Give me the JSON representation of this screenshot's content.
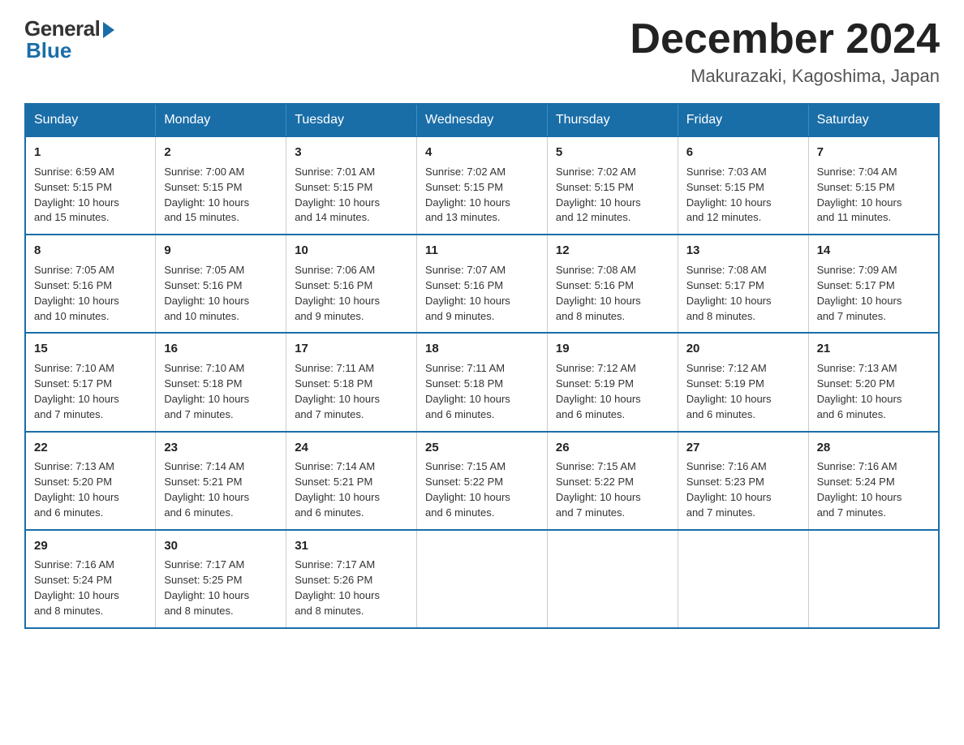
{
  "logo": {
    "general": "General",
    "blue": "Blue"
  },
  "title": "December 2024",
  "subtitle": "Makurazaki, Kagoshima, Japan",
  "days_of_week": [
    "Sunday",
    "Monday",
    "Tuesday",
    "Wednesday",
    "Thursday",
    "Friday",
    "Saturday"
  ],
  "weeks": [
    [
      {
        "day": "1",
        "sunrise": "6:59 AM",
        "sunset": "5:15 PM",
        "daylight": "10 hours and 15 minutes."
      },
      {
        "day": "2",
        "sunrise": "7:00 AM",
        "sunset": "5:15 PM",
        "daylight": "10 hours and 15 minutes."
      },
      {
        "day": "3",
        "sunrise": "7:01 AM",
        "sunset": "5:15 PM",
        "daylight": "10 hours and 14 minutes."
      },
      {
        "day": "4",
        "sunrise": "7:02 AM",
        "sunset": "5:15 PM",
        "daylight": "10 hours and 13 minutes."
      },
      {
        "day": "5",
        "sunrise": "7:02 AM",
        "sunset": "5:15 PM",
        "daylight": "10 hours and 12 minutes."
      },
      {
        "day": "6",
        "sunrise": "7:03 AM",
        "sunset": "5:15 PM",
        "daylight": "10 hours and 12 minutes."
      },
      {
        "day": "7",
        "sunrise": "7:04 AM",
        "sunset": "5:15 PM",
        "daylight": "10 hours and 11 minutes."
      }
    ],
    [
      {
        "day": "8",
        "sunrise": "7:05 AM",
        "sunset": "5:16 PM",
        "daylight": "10 hours and 10 minutes."
      },
      {
        "day": "9",
        "sunrise": "7:05 AM",
        "sunset": "5:16 PM",
        "daylight": "10 hours and 10 minutes."
      },
      {
        "day": "10",
        "sunrise": "7:06 AM",
        "sunset": "5:16 PM",
        "daylight": "10 hours and 9 minutes."
      },
      {
        "day": "11",
        "sunrise": "7:07 AM",
        "sunset": "5:16 PM",
        "daylight": "10 hours and 9 minutes."
      },
      {
        "day": "12",
        "sunrise": "7:08 AM",
        "sunset": "5:16 PM",
        "daylight": "10 hours and 8 minutes."
      },
      {
        "day": "13",
        "sunrise": "7:08 AM",
        "sunset": "5:17 PM",
        "daylight": "10 hours and 8 minutes."
      },
      {
        "day": "14",
        "sunrise": "7:09 AM",
        "sunset": "5:17 PM",
        "daylight": "10 hours and 7 minutes."
      }
    ],
    [
      {
        "day": "15",
        "sunrise": "7:10 AM",
        "sunset": "5:17 PM",
        "daylight": "10 hours and 7 minutes."
      },
      {
        "day": "16",
        "sunrise": "7:10 AM",
        "sunset": "5:18 PM",
        "daylight": "10 hours and 7 minutes."
      },
      {
        "day": "17",
        "sunrise": "7:11 AM",
        "sunset": "5:18 PM",
        "daylight": "10 hours and 7 minutes."
      },
      {
        "day": "18",
        "sunrise": "7:11 AM",
        "sunset": "5:18 PM",
        "daylight": "10 hours and 6 minutes."
      },
      {
        "day": "19",
        "sunrise": "7:12 AM",
        "sunset": "5:19 PM",
        "daylight": "10 hours and 6 minutes."
      },
      {
        "day": "20",
        "sunrise": "7:12 AM",
        "sunset": "5:19 PM",
        "daylight": "10 hours and 6 minutes."
      },
      {
        "day": "21",
        "sunrise": "7:13 AM",
        "sunset": "5:20 PM",
        "daylight": "10 hours and 6 minutes."
      }
    ],
    [
      {
        "day": "22",
        "sunrise": "7:13 AM",
        "sunset": "5:20 PM",
        "daylight": "10 hours and 6 minutes."
      },
      {
        "day": "23",
        "sunrise": "7:14 AM",
        "sunset": "5:21 PM",
        "daylight": "10 hours and 6 minutes."
      },
      {
        "day": "24",
        "sunrise": "7:14 AM",
        "sunset": "5:21 PM",
        "daylight": "10 hours and 6 minutes."
      },
      {
        "day": "25",
        "sunrise": "7:15 AM",
        "sunset": "5:22 PM",
        "daylight": "10 hours and 6 minutes."
      },
      {
        "day": "26",
        "sunrise": "7:15 AM",
        "sunset": "5:22 PM",
        "daylight": "10 hours and 7 minutes."
      },
      {
        "day": "27",
        "sunrise": "7:16 AM",
        "sunset": "5:23 PM",
        "daylight": "10 hours and 7 minutes."
      },
      {
        "day": "28",
        "sunrise": "7:16 AM",
        "sunset": "5:24 PM",
        "daylight": "10 hours and 7 minutes."
      }
    ],
    [
      {
        "day": "29",
        "sunrise": "7:16 AM",
        "sunset": "5:24 PM",
        "daylight": "10 hours and 8 minutes."
      },
      {
        "day": "30",
        "sunrise": "7:17 AM",
        "sunset": "5:25 PM",
        "daylight": "10 hours and 8 minutes."
      },
      {
        "day": "31",
        "sunrise": "7:17 AM",
        "sunset": "5:26 PM",
        "daylight": "10 hours and 8 minutes."
      },
      null,
      null,
      null,
      null
    ]
  ],
  "labels": {
    "sunrise": "Sunrise:",
    "sunset": "Sunset:",
    "daylight": "Daylight:"
  }
}
